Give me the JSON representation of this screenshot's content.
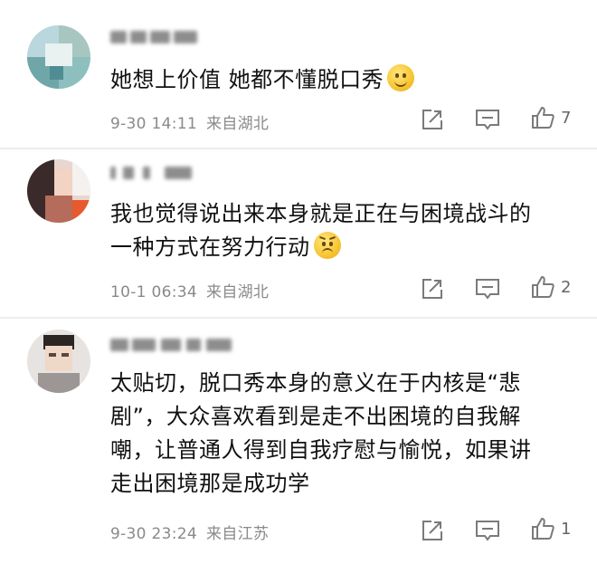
{
  "comments": [
    {
      "text_lines": [
        "她想上价值 她都不懂脱口秀"
      ],
      "has_emoji": true,
      "emoji": "smile-emoji",
      "date": "9-30 14:11",
      "location": "来自湖北",
      "likes": "7"
    },
    {
      "text_lines": [
        "我也觉得说出来本身就是正在与困境战斗的",
        "一种方式在努力行动"
      ],
      "has_emoji": true,
      "emoji": "grimace-emoji",
      "date": "10-1 06:34",
      "location": "来自湖北",
      "likes": "2"
    },
    {
      "text_lines": [
        "太贴切，脱口秀本身的意义在于内核是“悲",
        "剧”，大众喜欢看到是走不出困境的自我解",
        "嘲，让普通人得到自我疗慰与愉悦，如果讲",
        "走出困境那是成功学"
      ],
      "has_emoji": false,
      "date": "9-30 23:24",
      "location": "来自江苏",
      "likes": "1"
    }
  ],
  "colors": {
    "text": "#111111",
    "meta": "#8a8a8a",
    "icon": "#7a7a7a",
    "divider": "#ececec"
  }
}
